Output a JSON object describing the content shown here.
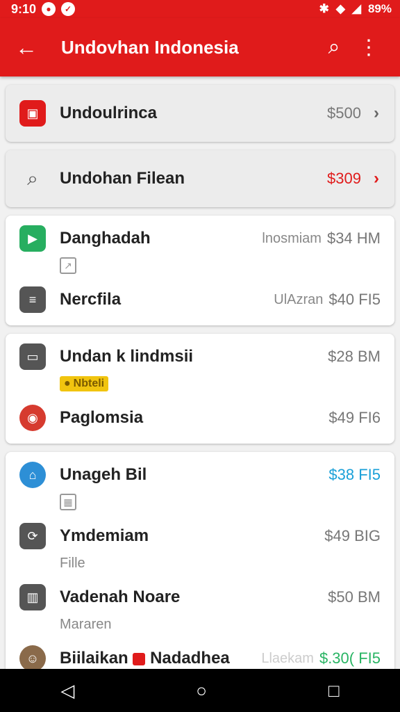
{
  "status": {
    "time": "9:10",
    "battery": "89%"
  },
  "appbar": {
    "title": "Undovhan Indonesia"
  },
  "cards": [
    {
      "type": "row",
      "style": "gray",
      "icon": "gift-icon",
      "icon_color": "#e01b1b",
      "name": "Undoulrinca",
      "price": "$500",
      "price_color": "gray",
      "chev": "gray"
    },
    {
      "type": "row",
      "style": "gray",
      "icon": "search-icon",
      "name": "Undohan Filean",
      "price": "$309",
      "price_color": "red",
      "chev": "red"
    }
  ],
  "groups": [
    {
      "items": [
        {
          "icon": "play-icon",
          "icon_color": "#27ae60",
          "name": "Danghadah",
          "note": "lnosmiam",
          "price": "$34 HM",
          "sub_icon": "share-icon"
        },
        {
          "icon": "document-icon",
          "icon_color": "#555555",
          "name": "Nercfila",
          "note": "UlAzran",
          "price": "$40 FI5"
        }
      ]
    },
    {
      "items": [
        {
          "icon": "card-icon",
          "icon_color": "#555555",
          "name": "Undan k lindmsii",
          "price": "$28 BM",
          "badge": "Nbteli"
        },
        {
          "icon": "target-icon",
          "icon_color": "#d63b2f",
          "name": "Paglomsia",
          "price": "$49 FI6"
        }
      ]
    },
    {
      "items": [
        {
          "icon": "home-icon",
          "icon_color": "#2d8fd6",
          "name": "Unageh Bil",
          "price": "$38 FI5",
          "price_color": "blue",
          "sub_icon": "image-icon"
        },
        {
          "icon": "refresh-icon",
          "icon_color": "#555555",
          "name": "Ymdemiam",
          "price": "$49 BIG",
          "sub": "Fille"
        },
        {
          "icon": "trash-icon",
          "icon_color": "#555555",
          "name": "Vadenah Noare",
          "price": "$50 BM",
          "sub": "Mararen"
        },
        {
          "icon": "avatar-icon",
          "icon_color": "#8a6a4a",
          "name": "Biilaikan",
          "name2": "Nadadhea",
          "note": "Llaekam",
          "price": "$.30( FI5",
          "price_color": "green"
        }
      ]
    }
  ]
}
